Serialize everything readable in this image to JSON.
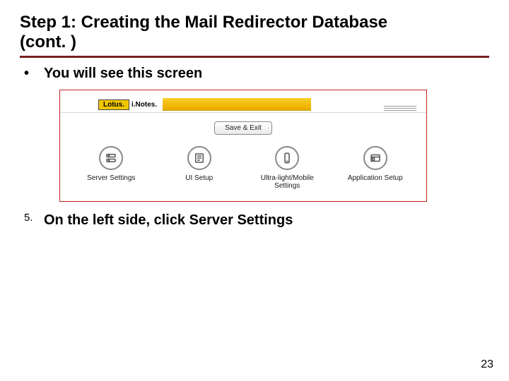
{
  "title_line1": "Step 1: Creating the Mail Redirector Database",
  "title_line2": "(cont. )",
  "bullets": {
    "b1": {
      "marker": "•",
      "text": "You will see this screen"
    },
    "b2": {
      "marker": "5.",
      "text": "On the left side, click Server Settings"
    }
  },
  "screenshot": {
    "brand_lotus": "Lotus.",
    "brand_inotes": "i.Notes.",
    "save_exit": "Save & Exit",
    "tiles": {
      "server": {
        "label": "Server Settings"
      },
      "ui": {
        "label": "UI Setup"
      },
      "mobile": {
        "label": "Ultra-light/Mobile Settings"
      },
      "app": {
        "label": "Application Setup"
      }
    }
  },
  "page_number": "23"
}
